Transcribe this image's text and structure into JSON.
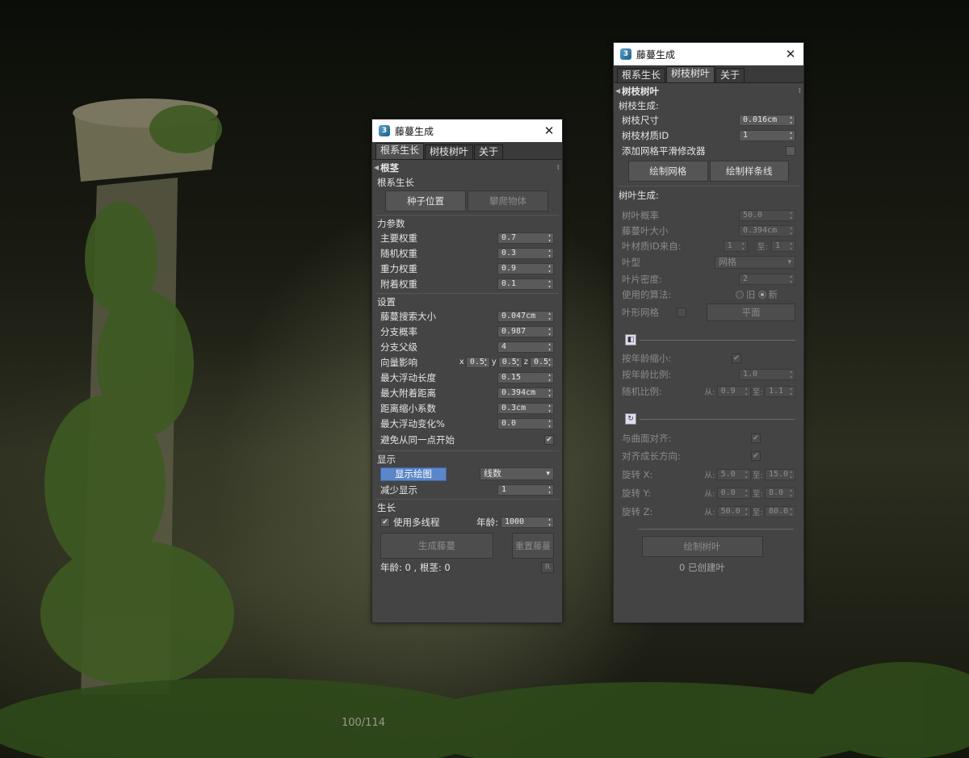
{
  "background": {
    "page_counter": "100/114"
  },
  "dialog_left": {
    "title": "藤蔓生成",
    "tabs": [
      "根系生长",
      "树枝树叶",
      "关于"
    ],
    "rollout_title": "根茎",
    "root_growth": {
      "label": "根系生长",
      "seed_button": "种子位置",
      "climb_button": "攀爬物体"
    },
    "force": {
      "label": "力参数",
      "rows": [
        {
          "label": "主要权重",
          "value": "0.7"
        },
        {
          "label": "随机权重",
          "value": "0.3"
        },
        {
          "label": "重力权重",
          "value": "0.9"
        },
        {
          "label": "附着权重",
          "value": "0.1"
        }
      ]
    },
    "settings": {
      "label": "设置",
      "rows": [
        {
          "label": "藤蔓搜索大小",
          "value": "0.047cm"
        },
        {
          "label": "分支概率",
          "value": "0.987"
        },
        {
          "label": "分支父级",
          "value": "4"
        }
      ],
      "direction": {
        "label": "向量影响",
        "x_label": "x",
        "x": "0.5",
        "y_label": "y",
        "y": "0.5",
        "z_label": "z",
        "z": "0.5"
      },
      "rows2": [
        {
          "label": "最大浮动长度",
          "value": "0.15"
        },
        {
          "label": "最大附着距离",
          "value": "0.394cm"
        },
        {
          "label": "距离缩小系数",
          "value": "0.3cm"
        },
        {
          "label": "最大浮动变化%",
          "value": "0.0"
        }
      ],
      "avoid_label": "避免从同一点开始",
      "avoid_checked": "✔"
    },
    "display": {
      "label": "显示",
      "show_button": "显示绘图",
      "mode_value": "线数",
      "reduce_label": "减少显示",
      "reduce_value": "1"
    },
    "growth": {
      "label": "生长",
      "multithread_label": "使用多线程",
      "multithread_checked": "✔",
      "age_label": "年龄:",
      "age_value": "1000",
      "generate_button": "生成藤蔓",
      "reset_button": "重置藤蔓",
      "status_text": "年龄: 0 , 根茎: 0",
      "r_button": "R"
    }
  },
  "dialog_right": {
    "title": "藤蔓生成",
    "tabs": [
      "根系生长",
      "树枝树叶",
      "关于"
    ],
    "rollout_title": "树枝树叶",
    "branch": {
      "label": "树枝生成:",
      "size_label": "树枝尺寸",
      "size_value": "0.016cm",
      "matid_label": "树枝材质ID",
      "matid_value": "1",
      "smooth_label": "添加网格平滑修改器",
      "draw_mesh_button": "绘制网格",
      "draw_spline_button": "绘制样条线"
    },
    "leaf": {
      "label": "树叶生成:",
      "prob_label": "树叶概率",
      "prob_value": "50.0",
      "size_label": "藤蔓叶大小",
      "size_value": "0.394cm",
      "matid_label": "叶材质ID来自:",
      "matid_from": "1",
      "matid_to_label": "至:",
      "matid_to": "1",
      "type_label": "叶型",
      "type_value": "网格",
      "density_label": "叶片密度:",
      "density_value": "2",
      "algo_label": "使用的算法:",
      "algo_old": "旧",
      "algo_new": "新",
      "leaf_mesh_label": "叶形网格",
      "plane_button": "平面",
      "scale": {
        "age_label": "按年龄缩小:",
        "age_checked": "✔",
        "ratio_label": "按年龄比例:",
        "ratio_value": "1.0",
        "random_label": "随机比例:",
        "from_label": "从:",
        "from_value": "0.9",
        "to_label": "至:",
        "to_value": "1.1"
      },
      "rotate": {
        "align_label": "与曲面对齐:",
        "align_checked": "✔",
        "grow_label": "对齐成长方向:",
        "grow_checked": "✔",
        "rows": [
          {
            "label": "旋转 X:",
            "from_label": "从:",
            "from": "5.0",
            "to_label": "至:",
            "to": "15.0"
          },
          {
            "label": "旋转 Y:",
            "from_label": "从:",
            "from": "0.0",
            "to_label": "至:",
            "to": "8.0"
          },
          {
            "label": "旋转 Z:",
            "from_label": "从:",
            "from": "50.0",
            "to_label": "至:",
            "to": "80.0"
          }
        ]
      },
      "draw_leaf_button": "绘制树叶",
      "status_text": "0 已创建叶"
    }
  }
}
